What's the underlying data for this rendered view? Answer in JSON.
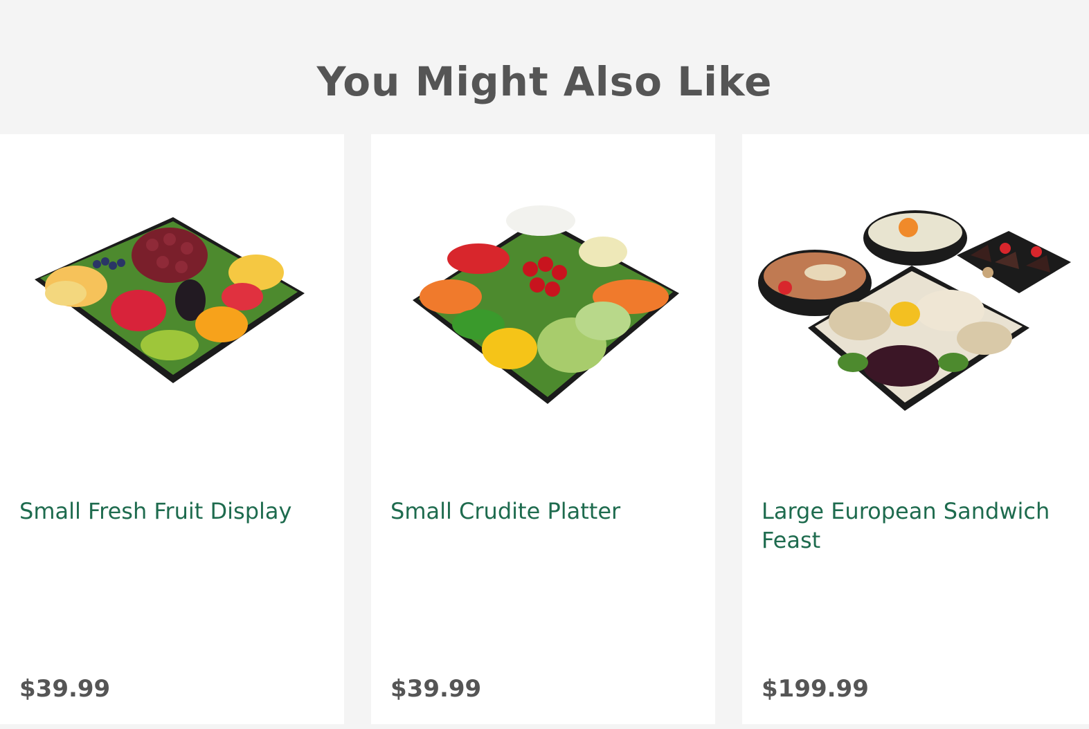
{
  "section": {
    "title": "You Might Also Like"
  },
  "products": [
    {
      "name": "Small Fresh Fruit Display",
      "price": "$39.99",
      "image_icon": "fruit-platter-image"
    },
    {
      "name": "Small Crudite Platter",
      "price": "$39.99",
      "image_icon": "crudite-platter-image"
    },
    {
      "name": "Large European Sandwich Feast",
      "price": "$199.99",
      "image_icon": "sandwich-feast-image"
    }
  ],
  "colors": {
    "page_background": "#f4f4f4",
    "card_background": "#ffffff",
    "title_text": "#555555",
    "product_name": "#1e6b4e",
    "price_text": "#555555"
  }
}
